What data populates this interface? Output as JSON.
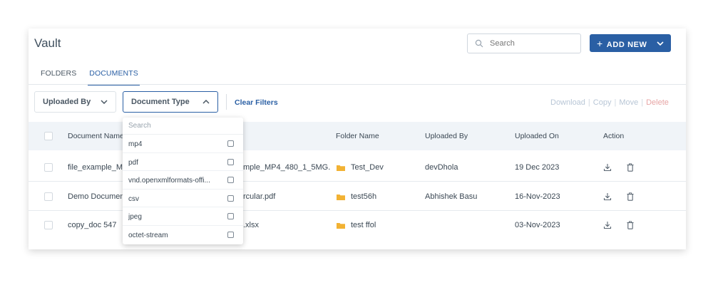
{
  "header": {
    "title": "Vault",
    "search_placeholder": "Search",
    "add_new_label": "ADD NEW"
  },
  "tabs": [
    {
      "label": "FOLDERS",
      "active": false
    },
    {
      "label": "DOCUMENTS",
      "active": true
    }
  ],
  "filters": {
    "uploaded_by_label": "Uploaded By",
    "document_type_label": "Document Type",
    "clear_label": "Clear Filters"
  },
  "bulk_actions": {
    "download": "Download",
    "copy": "Copy",
    "move": "Move",
    "delete": "Delete",
    "separator": "|"
  },
  "table": {
    "columns": [
      "Document Name",
      "Folder Name",
      "Uploaded By",
      "Uploaded On",
      "Action"
    ],
    "rows": [
      {
        "name_start": "file_example_MI",
        "name_end": "mple_MP4_480_1_5MG.",
        "folder": "Test_Dev",
        "uploaded_by": "devDhola",
        "uploaded_on": "19 Dec 2023"
      },
      {
        "name_start": "Demo Documen",
        "name_end": "rcular.pdf",
        "folder": "test56h",
        "uploaded_by": "Abhishek Basu",
        "uploaded_on": "16-Nov-2023"
      },
      {
        "name_start": "copy_doc 547",
        "name_end": ".xlsx",
        "folder": "test ffol",
        "uploaded_by": "",
        "uploaded_on": "03-Nov-2023"
      }
    ]
  },
  "document_type_dropdown": {
    "search_placeholder": "Search",
    "options": [
      "mp4",
      "pdf",
      "vnd.openxmlformats-offi...",
      "csv",
      "jpeg",
      "octet-stream"
    ]
  },
  "colors": {
    "accent": "#2a5fa4",
    "folder": "#f2b233",
    "header_bg": "#f0f4f8",
    "delete_disabled": "#e7a5a5",
    "action_disabled": "#b8c6d6"
  }
}
